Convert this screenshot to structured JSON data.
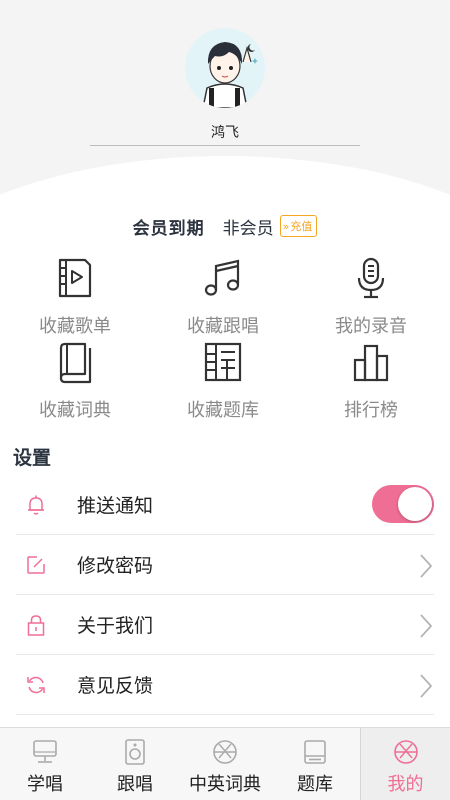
{
  "profile": {
    "username": "鸿飞"
  },
  "membership": {
    "label": "会员到期",
    "status": "非会员",
    "recharge": "充值",
    "recharge_arrows": "»"
  },
  "grid": [
    {
      "label": "收藏歌单",
      "icon": "video-file-icon"
    },
    {
      "label": "收藏跟唱",
      "icon": "music-note-icon"
    },
    {
      "label": "我的录音",
      "icon": "microphone-icon"
    },
    {
      "label": "收藏词典",
      "icon": "book-icon"
    },
    {
      "label": "收藏题库",
      "icon": "question-bank-icon"
    },
    {
      "label": "排行榜",
      "icon": "ranking-icon"
    }
  ],
  "settings": {
    "title": "设置",
    "items": [
      {
        "label": "推送通知",
        "icon": "bell-icon",
        "toggle_on": true
      },
      {
        "label": "修改密码",
        "icon": "edit-icon"
      },
      {
        "label": "关于我们",
        "icon": "lock-icon"
      },
      {
        "label": "意见反馈",
        "icon": "refresh-icon"
      }
    ]
  },
  "tabs": [
    {
      "label": "学唱",
      "icon": "monitor-icon"
    },
    {
      "label": "跟唱",
      "icon": "speaker-icon"
    },
    {
      "label": "中英词典",
      "icon": "aperture-icon"
    },
    {
      "label": "题库",
      "icon": "card-icon"
    },
    {
      "label": "我的",
      "icon": "aperture-icon",
      "active": true
    }
  ],
  "colors": {
    "accent": "#ef6e95",
    "recharge": "#f5a623",
    "grid_text": "#8a8a8a",
    "heading": "#2c3440"
  }
}
